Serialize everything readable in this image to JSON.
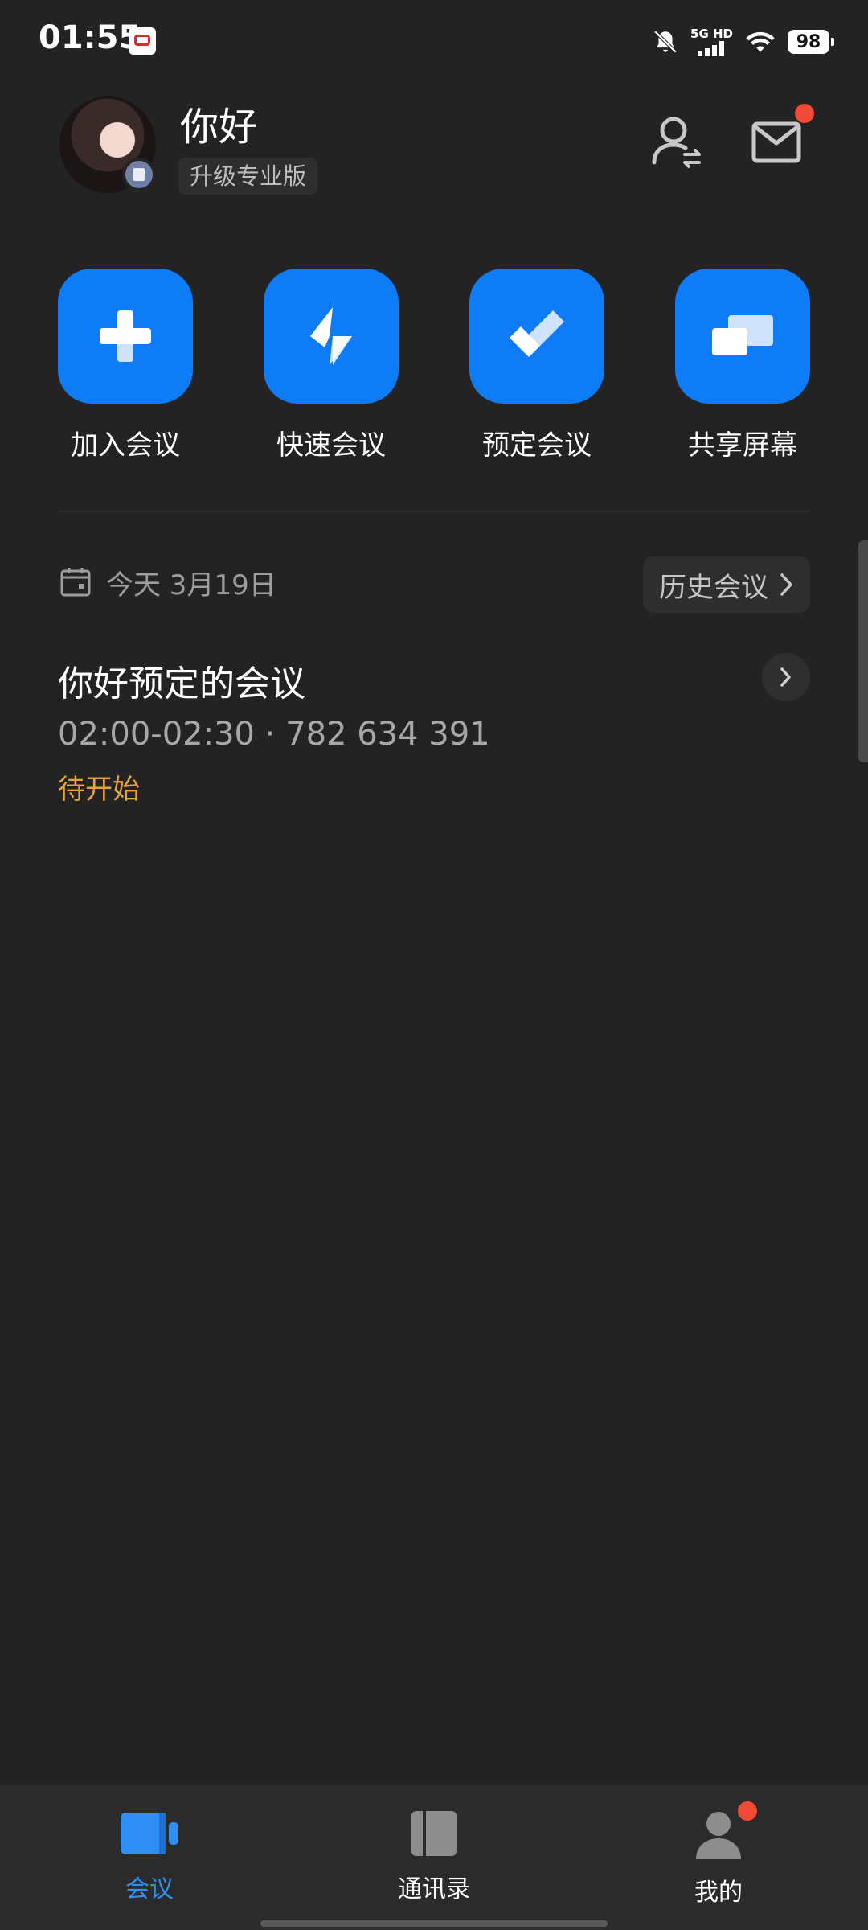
{
  "status_bar": {
    "time": "01:55",
    "network_label_top": "5G HD",
    "battery": "98",
    "icons": [
      "mute-bell-icon",
      "signal-icon",
      "wifi-icon",
      "battery-icon"
    ]
  },
  "header": {
    "username": "你好",
    "upgrade_label": "升级专业版",
    "unread_dot_color": "#f24a37"
  },
  "actions": [
    {
      "label": "加入会议",
      "icon": "plus-icon"
    },
    {
      "label": "快速会议",
      "icon": "lightning-icon"
    },
    {
      "label": "预定会议",
      "icon": "check-icon"
    },
    {
      "label": "共享屏幕",
      "icon": "share-screen-icon"
    }
  ],
  "schedule": {
    "date": "今天 3月19日",
    "history_label": "历史会议"
  },
  "meeting": {
    "title": "你好预定的会议",
    "time_and_id": "02:00-02:30 · 782 634 391",
    "status": "待开始",
    "status_color": "#e8a23a"
  },
  "bottom_nav": [
    {
      "label": "会议",
      "icon": "video-camera-icon",
      "active": true
    },
    {
      "label": "通讯录",
      "icon": "contacts-book-icon",
      "active": false
    },
    {
      "label": "我的",
      "icon": "person-icon",
      "active": false
    }
  ],
  "colors": {
    "accent": "#0e7cf6",
    "active_tab": "#2f8ff5",
    "background": "#232323"
  }
}
